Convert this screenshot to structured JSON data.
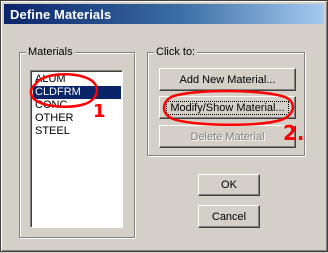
{
  "window": {
    "title": "Define Materials"
  },
  "materials_group": {
    "label": "Materials",
    "items": [
      {
        "label": "ALUM",
        "selected": false
      },
      {
        "label": "CLDFRM",
        "selected": true
      },
      {
        "label": "CONC",
        "selected": false
      },
      {
        "label": "OTHER",
        "selected": false
      },
      {
        "label": "STEEL",
        "selected": false
      }
    ]
  },
  "click_group": {
    "label": "Click to:",
    "add_button": "Add New Material...",
    "modify_button": "Modify/Show Material...",
    "delete_button": "Delete Material"
  },
  "dialog_buttons": {
    "ok": "OK",
    "cancel": "Cancel"
  },
  "annotations": {
    "marker_1": "1",
    "marker_2": "2.",
    "color": "#ff0000"
  }
}
